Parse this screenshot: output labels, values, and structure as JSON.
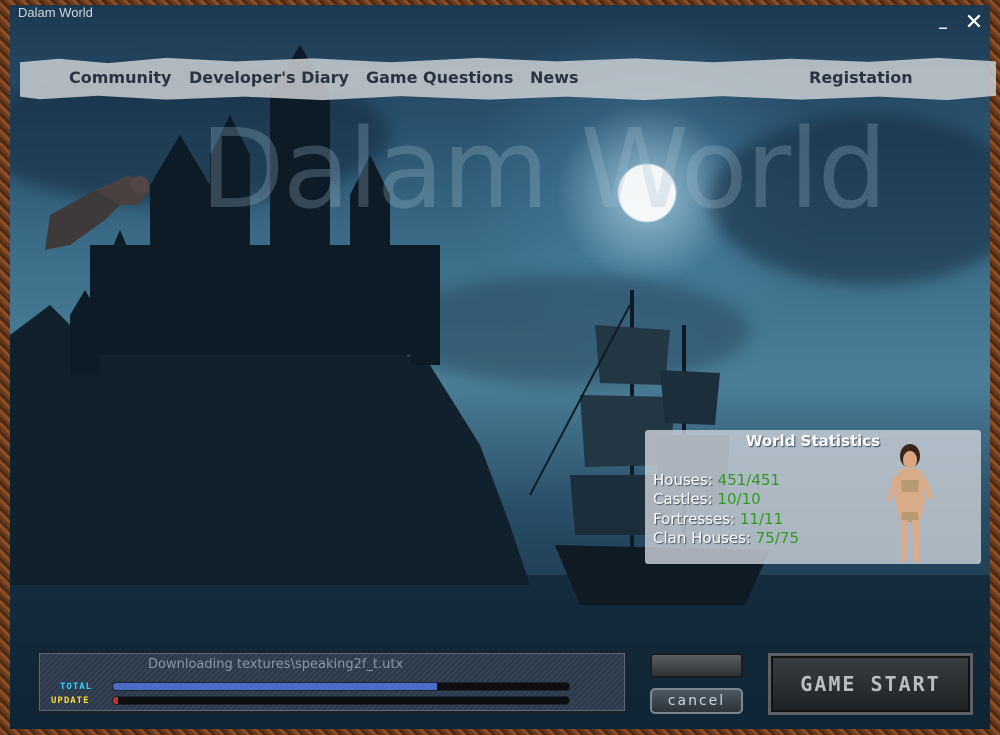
{
  "window": {
    "title": "Dalam World",
    "minimize_glyph": "_",
    "close_glyph": "✕"
  },
  "nav": {
    "community": "Community",
    "developers_diary": "Developer's Diary",
    "game_questions": "Game Questions",
    "news": "News",
    "registration": "Registation"
  },
  "watermark": "Dalam World",
  "stats": {
    "title": "World Statistics",
    "rows": [
      {
        "label": "Houses:",
        "value": "451/451"
      },
      {
        "label": "Castles:",
        "value": "10/10"
      },
      {
        "label": "Fortresses:",
        "value": "11/11"
      },
      {
        "label": "Clan Houses:",
        "value": "75/75"
      }
    ]
  },
  "download": {
    "status_text": "Downloading textures\\speaking2f_t.utx",
    "total_label": "TOTAL",
    "update_label": "UPDATE",
    "total_progress": 0.71,
    "update_progress": 0.01
  },
  "buttons": {
    "cancel": "cancel",
    "game_start": "GAME START"
  },
  "colors": {
    "stat_value": "#2e9a22",
    "total_label": "#2fd0ff",
    "update_label": "#ffd63a",
    "total_fill": "#4a6cc4",
    "update_fill": "#c23030"
  }
}
